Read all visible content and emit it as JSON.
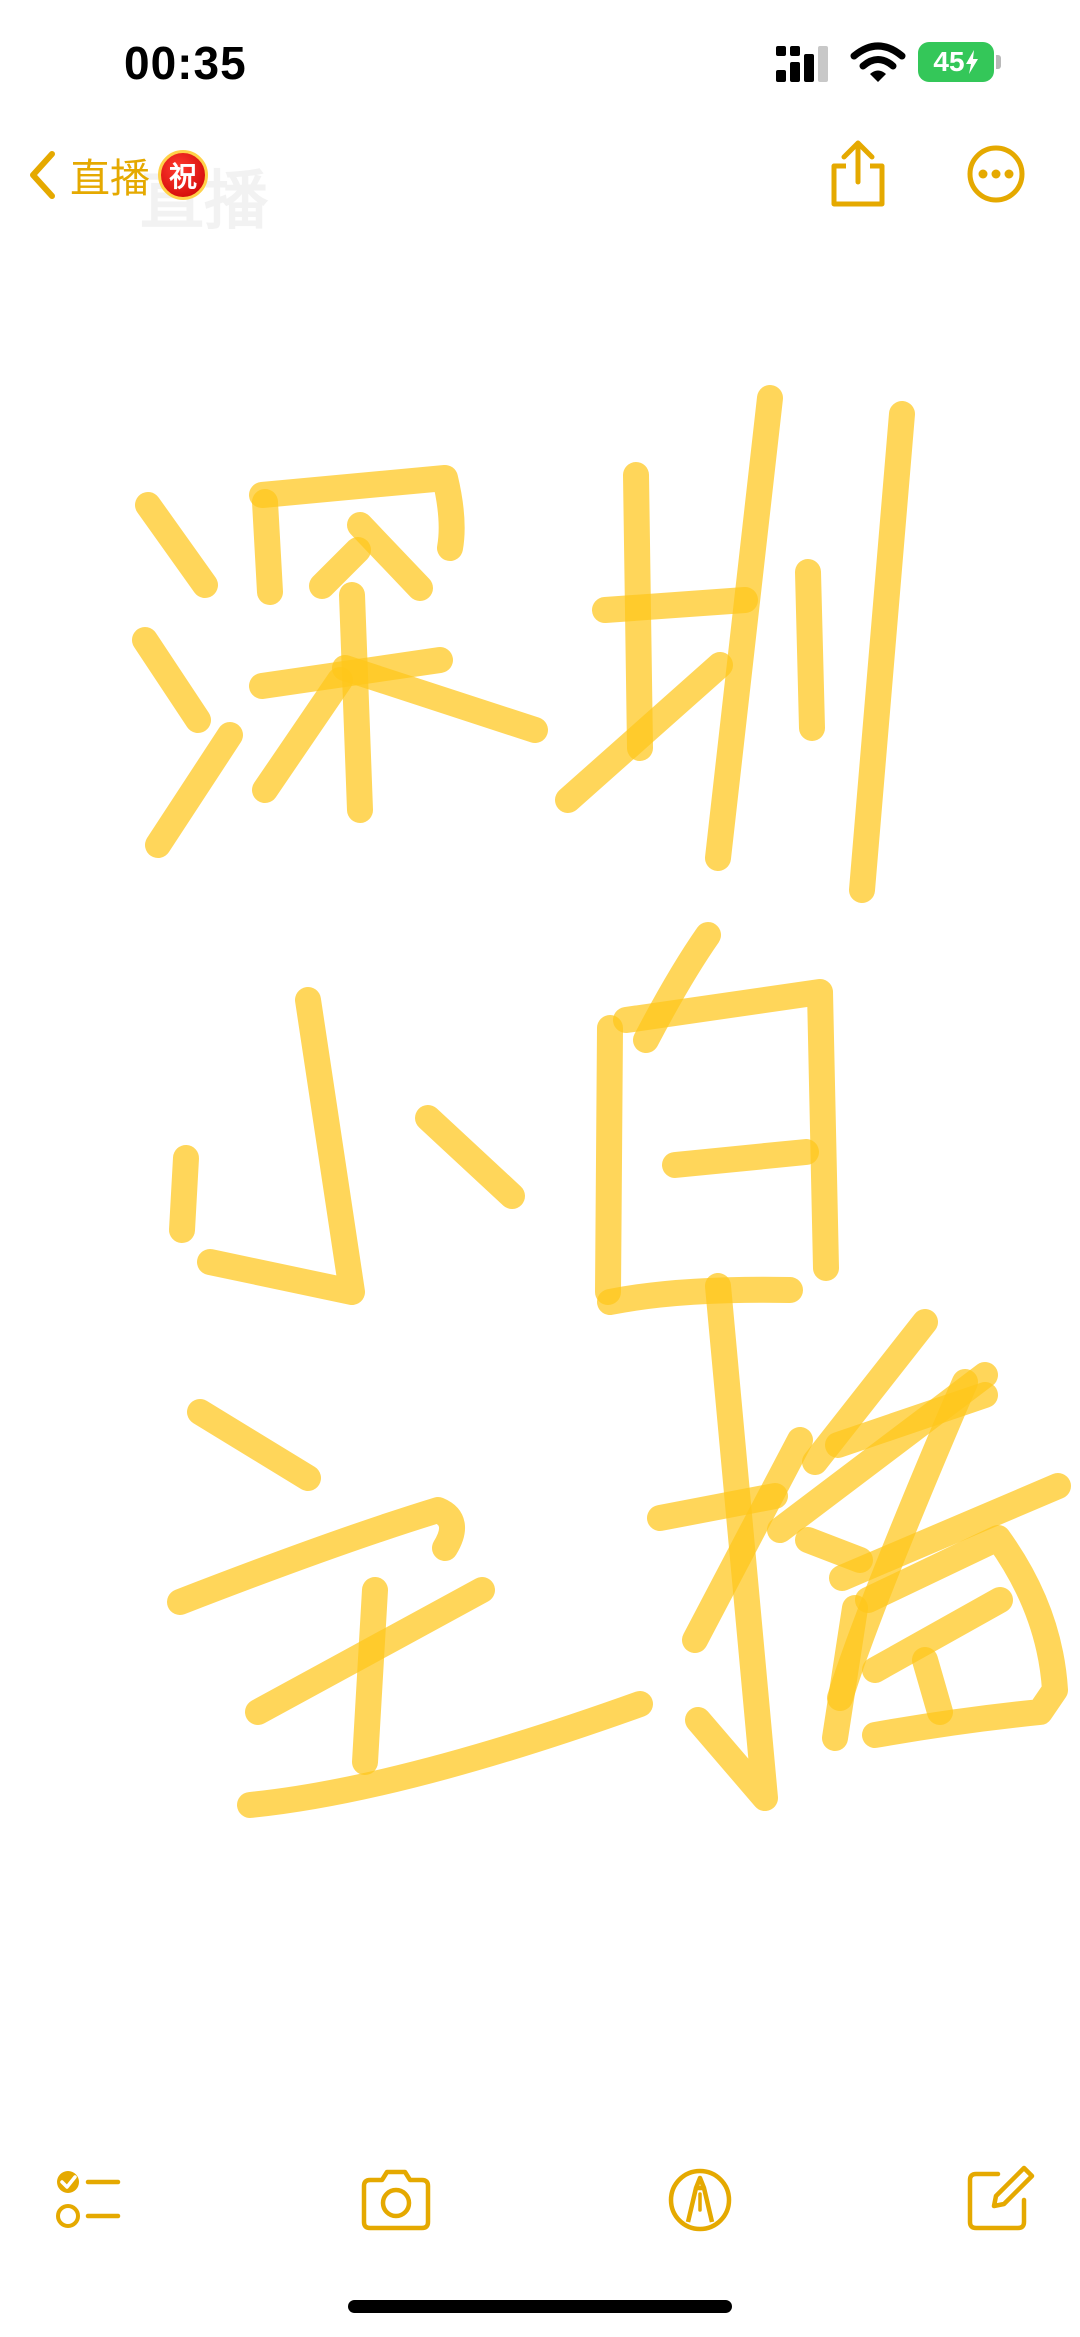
{
  "status_bar": {
    "time": "00:35",
    "battery_level": "45",
    "signal_icon": "cellular-signal-icon",
    "wifi_icon": "wifi-icon",
    "charging_icon": "bolt-icon"
  },
  "nav": {
    "back_label": "直播",
    "badge_text": "祝",
    "title_ghost": "直播",
    "subtitle_ghost": "",
    "share_icon": "share-icon",
    "more_icon": "ellipsis-circle-icon"
  },
  "note": {
    "handwriting_text": "深圳小白主播",
    "ink_color": "#ffc61a"
  },
  "toolbar": {
    "checklist_icon": "checklist-icon",
    "camera_icon": "camera-icon",
    "markup_icon": "markup-pen-icon",
    "compose_icon": "compose-icon"
  },
  "colors": {
    "accent": "#e5a900",
    "battery": "#34c759",
    "background": "#ffffff"
  }
}
